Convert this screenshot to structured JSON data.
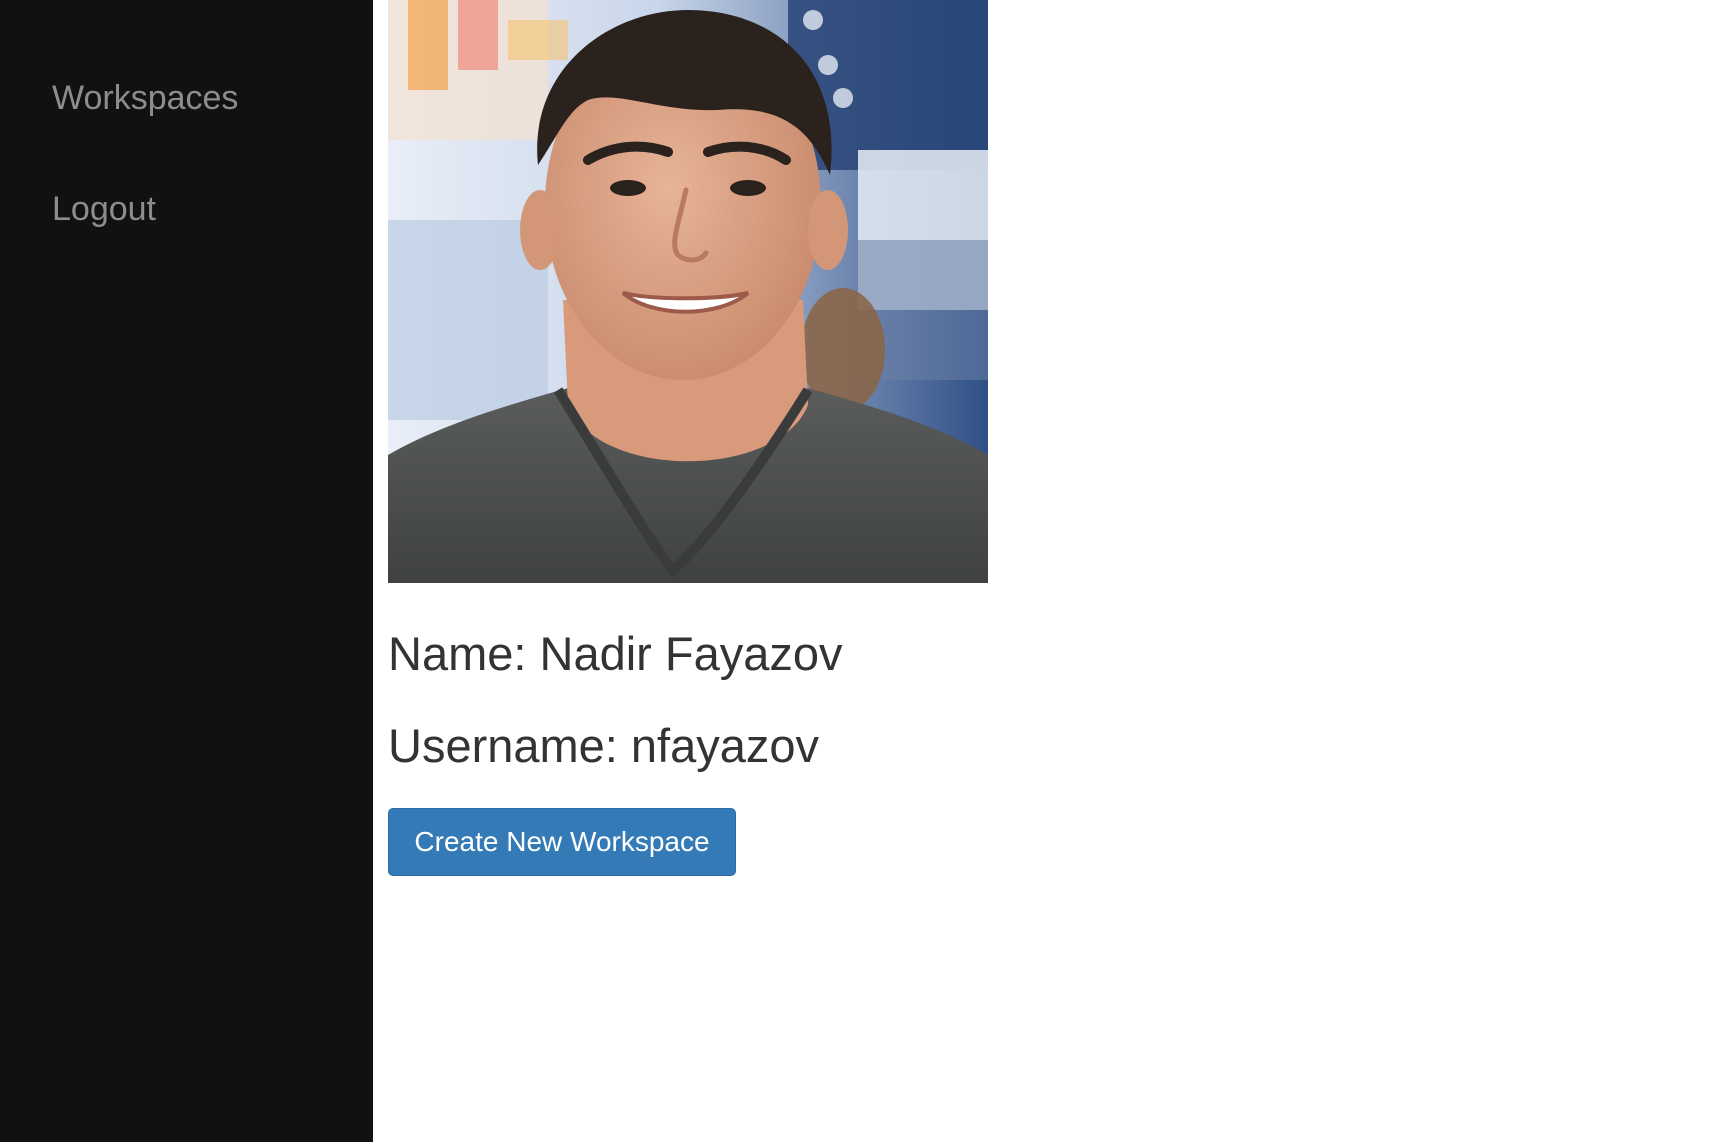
{
  "sidebar": {
    "items": [
      {
        "label": "Workspaces"
      },
      {
        "label": "Logout"
      }
    ]
  },
  "profile": {
    "photo_alt": "profile photo",
    "name_label": "Name:",
    "name_value": "Nadir Fayazov",
    "username_label": "Username:",
    "username_value": "nfayazov"
  },
  "actions": {
    "create_workspace_label": "Create New Workspace"
  },
  "colors": {
    "sidebar_bg": "#111111",
    "sidebar_text": "#8d8d8d",
    "primary_button": "#337ab7",
    "body_text": "#333333"
  }
}
